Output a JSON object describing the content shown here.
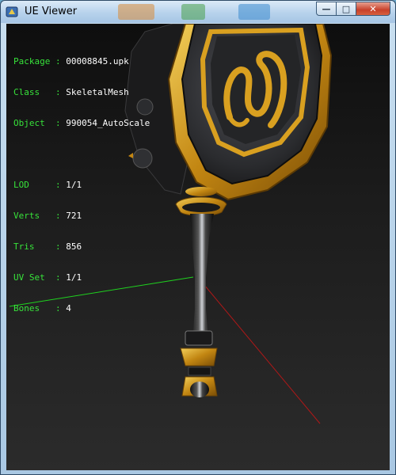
{
  "window": {
    "title": "UE Viewer",
    "controls": {
      "minimize": "—",
      "maximize": "□",
      "close": "✕"
    }
  },
  "info": {
    "group1": [
      {
        "key": "Package",
        "sep": " : ",
        "value": "00008845.upk"
      },
      {
        "key": "Class  ",
        "sep": " : ",
        "value": "SkeletalMesh"
      },
      {
        "key": "Object ",
        "sep": " : ",
        "value": "990054_AutoScale"
      }
    ],
    "group2": [
      {
        "key": "LOD    ",
        "sep": " : ",
        "value": "1/1"
      },
      {
        "key": "Verts  ",
        "sep": " : ",
        "value": "721"
      },
      {
        "key": "Tris   ",
        "sep": " : ",
        "value": "856"
      },
      {
        "key": "UV Set ",
        "sep": " : ",
        "value": "1/1"
      },
      {
        "key": "Bones  ",
        "sep": " : ",
        "value": "4"
      }
    ]
  },
  "colors": {
    "label": "#37e23a",
    "value": "#ffffff",
    "axis_x": "#1fd21f",
    "axis_y": "#b01818",
    "gold": "#d9a020",
    "metal": "#2a2a2c"
  },
  "icons": {
    "app": "ue-viewer-app-icon",
    "minimize": "minimize-icon",
    "maximize": "maximize-icon",
    "close": "close-icon"
  }
}
